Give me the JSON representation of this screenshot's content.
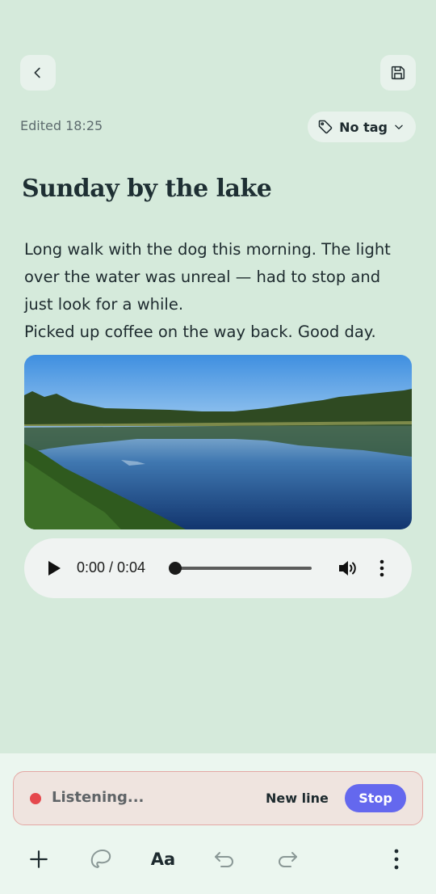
{
  "header": {
    "back_icon": "chevron-left-icon",
    "save_icon": "floppy-disk-icon"
  },
  "meta": {
    "edited": "Edited 18:25",
    "tag_label": "No tag",
    "tag_icon": "tag-icon"
  },
  "note": {
    "title": "Sunday by the lake",
    "lines": [
      "Long walk with the dog this morning. The light",
      "over the water was unreal — had to stop and",
      "just look for a while.",
      "Picked up coffee on the way back. Good day."
    ]
  },
  "audio": {
    "time": "0:00 / 0:04",
    "progress": 0.0
  },
  "dictation": {
    "status": "Listening...",
    "new_line": "New line",
    "stop": "Stop",
    "accent": "#6468ee",
    "dot_color": "#e5484d"
  },
  "toolbar": {
    "text_format": "Aa",
    "icons": [
      "plus-icon",
      "lasso-icon",
      "text-format-icon",
      "undo-icon",
      "redo-icon",
      "more-vertical-icon"
    ]
  }
}
